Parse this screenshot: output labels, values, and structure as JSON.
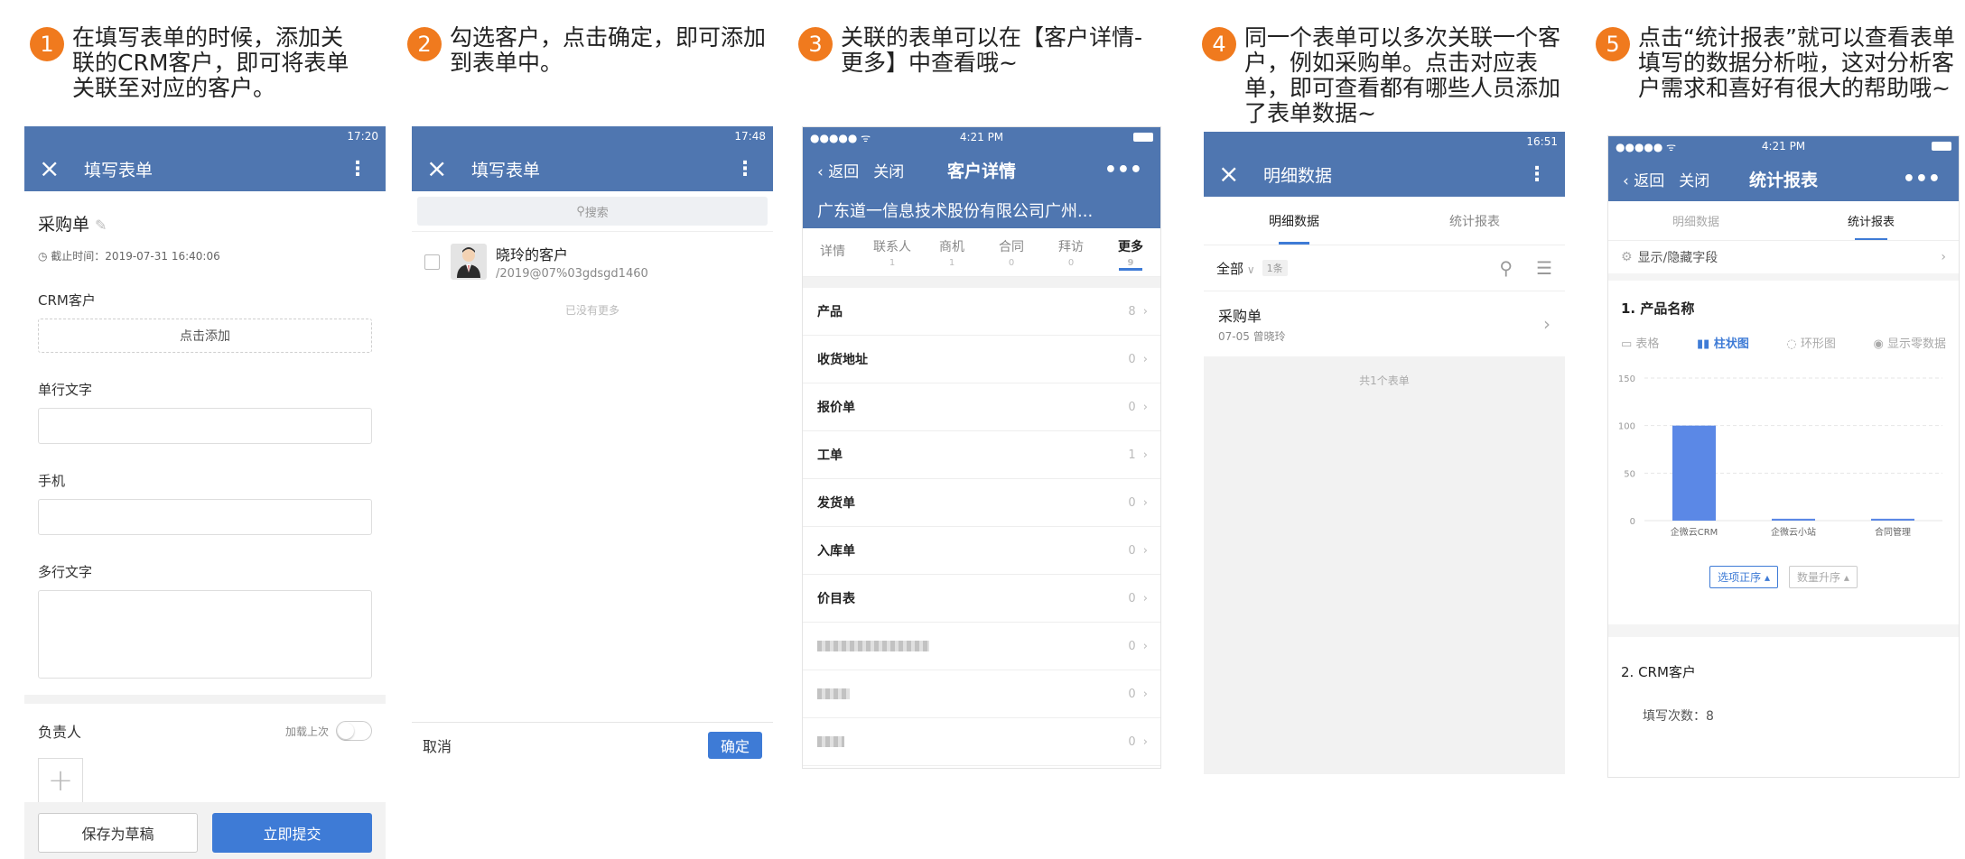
{
  "steps": [
    {
      "num": "1",
      "text": "在填写表单的时候，添加关联的CRM客户，即可将表单关联至对应的客户。"
    },
    {
      "num": "2",
      "text": "勾选客户，点击确定，即可添加到表单中。"
    },
    {
      "num": "3",
      "text": "关联的表单可以在【客户详情-更多】中查看哦~"
    },
    {
      "num": "4",
      "text": "同一个表单可以多次关联一个客户，例如采购单。点击对应表单，即可查看都有哪些人员添加了表单数据~"
    },
    {
      "num": "5",
      "text": "点击“统计报表”就可以查看表单填写的数据分析啦，这对分析客户需求和喜好有很大的帮助哦~"
    }
  ],
  "phone1": {
    "time": "17:20",
    "title": "填写表单",
    "form_title": "采购单",
    "deadline": "截止时间：2019-07-31 16:40:06",
    "crm_label": "CRM客户",
    "crm_add": "点击添加",
    "single_text": "单行文字",
    "mobile": "手机",
    "multi_text": "多行文字",
    "owner": "负责人",
    "load_last": "加载上次",
    "save_draft": "保存为草稿",
    "submit": "立即提交"
  },
  "phone2": {
    "time": "17:48",
    "title": "填写表单",
    "search_placeholder": "搜索",
    "customer_name": "晓玲的客户",
    "customer_sub": "/2019@07%03gdsgd1460",
    "no_more": "已没有更多",
    "cancel": "取消",
    "confirm": "确定"
  },
  "phone3": {
    "carrier": "●●●●● ᯤ",
    "time": "4:21 PM",
    "back": "‹ 返回",
    "close": "关闭",
    "title": "客户详情",
    "company": "广东道一信息技术股份有限公司广州...",
    "tabs": [
      {
        "label": "详情",
        "count": ""
      },
      {
        "label": "联系人",
        "count": "1"
      },
      {
        "label": "商机",
        "count": "1"
      },
      {
        "label": "合同",
        "count": "0"
      },
      {
        "label": "拜访",
        "count": "0"
      },
      {
        "label": "更多",
        "count": "9"
      }
    ],
    "rows": [
      {
        "name": "产品",
        "value": "8"
      },
      {
        "name": "收货地址",
        "value": "0"
      },
      {
        "name": "报价单",
        "value": "0"
      },
      {
        "name": "工单",
        "value": "1"
      },
      {
        "name": "发货单",
        "value": "0"
      },
      {
        "name": "入库单",
        "value": "0"
      },
      {
        "name": "价目表",
        "value": "0"
      }
    ],
    "blurred_values": [
      "0",
      "0",
      "0"
    ]
  },
  "phone4": {
    "time": "16:51",
    "title": "明细数据",
    "tab_detail": "明细数据",
    "tab_stats": "统计报表",
    "filter_all": "全部",
    "filter_count": "1条",
    "record_name": "采购单",
    "record_sub": "07-05 曾晓玲",
    "total": "共1个表单"
  },
  "phone5": {
    "carrier": "●●●●● ᯤ",
    "time": "4:21 PM",
    "back": "‹ 返回",
    "close": "关闭",
    "title": "统计报表",
    "tab_detail": "明细数据",
    "tab_stats": "统计报表",
    "toggle_fields": "显示/隐藏字段",
    "section1": "1. 产品名称",
    "chart_types": [
      "表格",
      "柱状图",
      "环形图",
      "显示零数据"
    ],
    "sort_asc": "选项正序 ▴",
    "sort_qty": "数量升序 ▴",
    "section2": "2. CRM客户",
    "fill_count": "填写次数：8"
  },
  "chart_data": {
    "type": "bar",
    "categories": [
      "企微云CRM",
      "企微云小站",
      "合同管理"
    ],
    "values": [
      100,
      2,
      2
    ],
    "yticks": [
      0,
      50,
      100,
      150
    ],
    "ylim": [
      0,
      150
    ],
    "color": "#5b88e6"
  }
}
